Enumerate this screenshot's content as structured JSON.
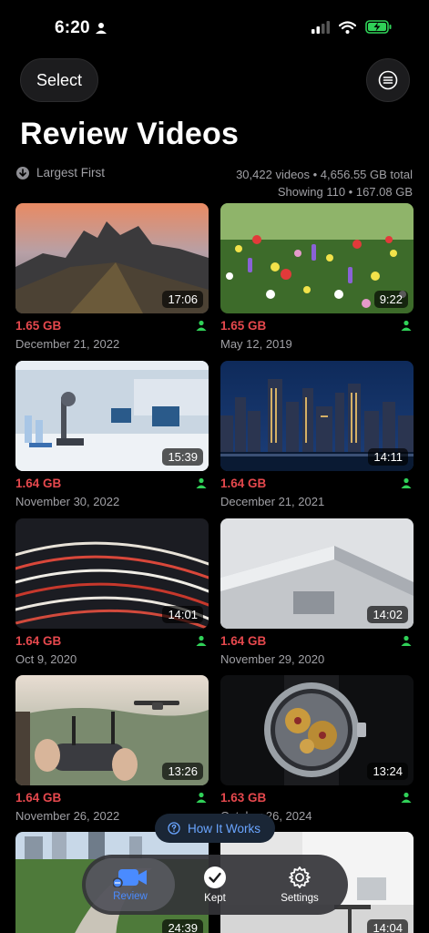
{
  "status": {
    "time": "6:20"
  },
  "header": {
    "select_label": "Select",
    "title": "Review Videos"
  },
  "sort": {
    "label": "Largest First"
  },
  "stats": {
    "line1": "30,422 videos • 4,656.55 GB total",
    "line2": "Showing 110 • 167.08 GB"
  },
  "videos": [
    {
      "duration": "17:06",
      "size": "1.65 GB",
      "date": "December 21, 2022",
      "thumb": "mountains-sunset"
    },
    {
      "duration": "9:22",
      "size": "1.65 GB",
      "date": "May 12, 2019",
      "thumb": "wildflowers"
    },
    {
      "duration": "15:39",
      "size": "1.64 GB",
      "date": "November 30, 2022",
      "thumb": "laboratory"
    },
    {
      "duration": "14:11",
      "size": "1.64 GB",
      "date": "December 21, 2021",
      "thumb": "city-skyline-night"
    },
    {
      "duration": "14:01",
      "size": "1.64 GB",
      "date": "Oct 9, 2020",
      "thumb": "light-trails"
    },
    {
      "duration": "14:02",
      "size": "1.64 GB",
      "date": "November 29, 2020",
      "thumb": "white-building"
    },
    {
      "duration": "13:26",
      "size": "1.64 GB",
      "date": "November 26, 2022",
      "thumb": "drone-controller"
    },
    {
      "duration": "13:24",
      "size": "1.63 GB",
      "date": "October 26, 2024",
      "thumb": "watch-mechanism"
    },
    {
      "duration": "24:39",
      "size": "",
      "date": "",
      "thumb": "park-city"
    },
    {
      "duration": "14:04",
      "size": "",
      "date": "",
      "thumb": "white-interior"
    }
  ],
  "how_it_works": {
    "label": "How It Works"
  },
  "tabs": {
    "review": "Review",
    "kept": "Kept",
    "settings": "Settings"
  },
  "colors": {
    "size_red": "#e5484d",
    "person_green": "#30d158",
    "accent_blue": "#4a8bff"
  }
}
